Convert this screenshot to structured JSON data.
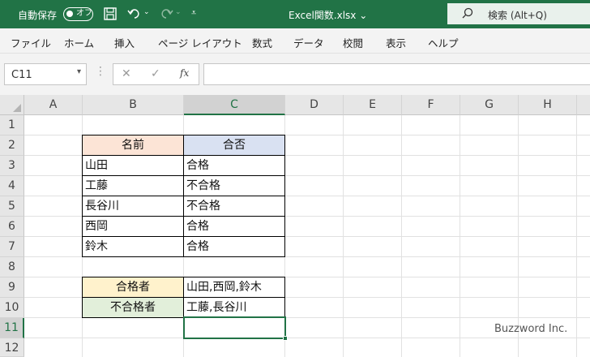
{
  "titlebar": {
    "autosave_label": "自動保存",
    "toggle_label": "オフ",
    "filename": "Excel関数.xlsx",
    "search_label": "検索 (Alt+Q)"
  },
  "ribbon_tabs": [
    "ファイル",
    "ホーム",
    "挿入",
    "ページ レイアウト",
    "数式",
    "データ",
    "校閲",
    "表示",
    "ヘルプ"
  ],
  "formula_bar": {
    "name_box": "C11",
    "fx_label": "fx",
    "formula": ""
  },
  "columns": [
    "A",
    "B",
    "C",
    "D",
    "E",
    "F",
    "G",
    "H"
  ],
  "rows": [
    "1",
    "2",
    "3",
    "4",
    "5",
    "6",
    "7",
    "8",
    "9",
    "10",
    "11",
    "12"
  ],
  "table": {
    "header_name": "名前",
    "header_result": "合否",
    "records": [
      {
        "name": "山田",
        "result": "合格"
      },
      {
        "name": "工藤",
        "result": "不合格"
      },
      {
        "name": "長谷川",
        "result": "不合格"
      },
      {
        "name": "西岡",
        "result": "合格"
      },
      {
        "name": "鈴木",
        "result": "合格"
      }
    ]
  },
  "summary": {
    "pass_label": "合格者",
    "pass_value": "山田,西岡,鈴木",
    "fail_label": "不合格者",
    "fail_value": "工藤,長谷川"
  },
  "selected_cell": "C11",
  "colors": {
    "excel_green": "#217346",
    "header_name_fill": "#fce4d6",
    "header_result_fill": "#d9e1f2",
    "pass_fill": "#fff2cc",
    "fail_fill": "#e2efda"
  },
  "watermark": "Buzzword Inc."
}
